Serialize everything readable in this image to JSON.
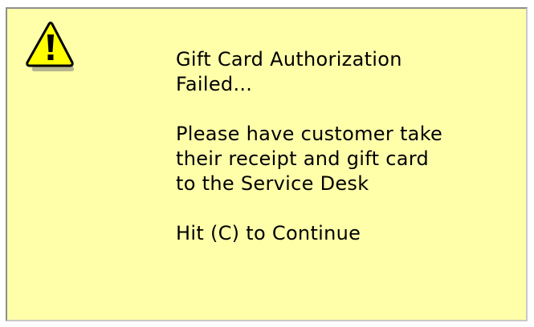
{
  "dialog": {
    "icon": "warning-icon",
    "background": "#ffffaa",
    "message": {
      "title_line1": "Gift Card Authorization",
      "title_line2": "Failed...",
      "instruction_line1": "Please have customer take",
      "instruction_line2": "their receipt and gift card",
      "instruction_line3": "to the Service Desk",
      "continue_prompt": "Hit (C) to Continue"
    }
  }
}
